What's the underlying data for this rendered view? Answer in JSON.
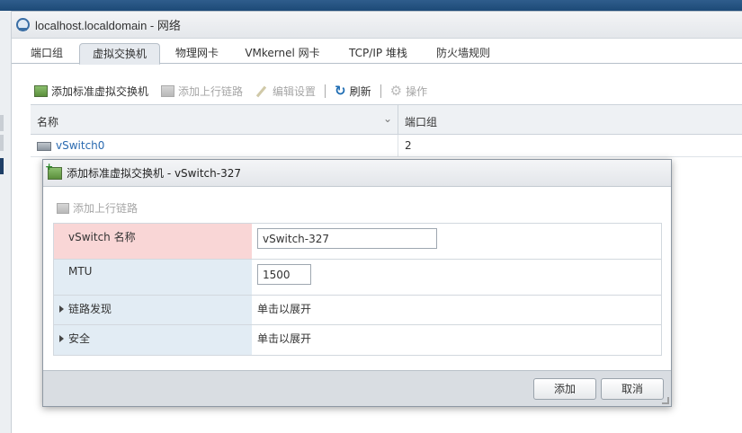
{
  "panel": {
    "title": "localhost.localdomain - 网络"
  },
  "tabs": [
    {
      "label": "端口组"
    },
    {
      "label": "虚拟交换机"
    },
    {
      "label": "物理网卡"
    },
    {
      "label": "VMkernel 网卡"
    },
    {
      "label": "TCP/IP 堆栈"
    },
    {
      "label": "防火墙规则"
    }
  ],
  "active_tab": "虚拟交换机",
  "toolbar": {
    "add_standard_switch": "添加标准虚拟交换机",
    "add_uplink": "添加上行链路",
    "edit_settings": "编辑设置",
    "refresh": "刷新",
    "actions": "操作"
  },
  "grid": {
    "columns": [
      "名称",
      "端口组"
    ],
    "rows": [
      {
        "name": "vSwitch0",
        "portgroups": "2"
      }
    ]
  },
  "modal": {
    "title": "添加标准虚拟交换机 - vSwitch-327",
    "add_uplink": "添加上行链路",
    "fields": {
      "vswitch_name_label": "vSwitch 名称",
      "vswitch_name_value": "vSwitch-327",
      "mtu_label": "MTU",
      "mtu_value": "1500",
      "link_discovery_label": "链路发现",
      "link_discovery_value": "单击以展开",
      "security_label": "安全",
      "security_value": "单击以展开"
    },
    "buttons": {
      "add": "添加",
      "cancel": "取消"
    }
  },
  "colors": {
    "accent": "#1f6db3",
    "error_field": "#f9d6d6",
    "label_bg": "#e2ecf4"
  }
}
